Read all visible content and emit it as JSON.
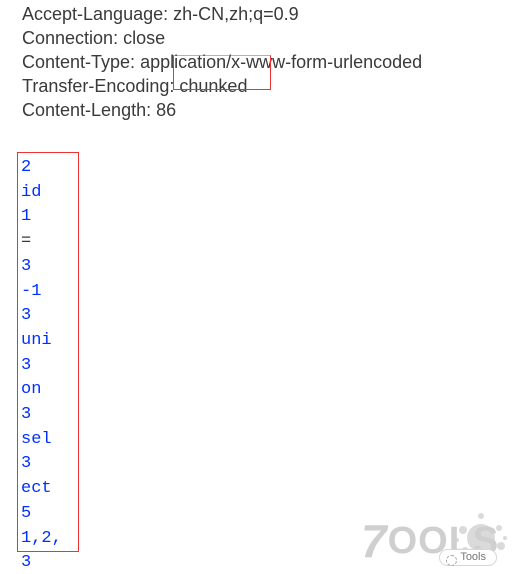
{
  "headers": [
    {
      "name": "Accept-Language",
      "value": "zh-CN,zh;q=0.9"
    },
    {
      "name": "Connection",
      "value": "close"
    },
    {
      "name": "Content-Type",
      "value": "application/x-www-form-urlencoded"
    },
    {
      "name": "Transfer-Encoding",
      "value": "chunked"
    },
    {
      "name": "Content-Length",
      "value": "86"
    }
  ],
  "body_lines": [
    {
      "t": "2",
      "c": "data"
    },
    {
      "t": "id",
      "c": "data"
    },
    {
      "t": "1",
      "c": "data"
    },
    {
      "t": "=",
      "c": "plain"
    },
    {
      "t": "3",
      "c": "data"
    },
    {
      "t": "-1",
      "c": "data"
    },
    {
      "t": "3",
      "c": "data"
    },
    {
      "t": "uni",
      "c": "data"
    },
    {
      "t": "3",
      "c": "data"
    },
    {
      "t": "on",
      "c": "data"
    },
    {
      "t": "3",
      "c": "data"
    },
    {
      "t": "sel",
      "c": "data"
    },
    {
      "t": "3",
      "c": "data"
    },
    {
      "t": "ect",
      "c": "data"
    },
    {
      "t": "5",
      "c": "data"
    },
    {
      "t": " 1,2,",
      "c": "data"
    },
    {
      "t": "3",
      "c": "data"
    }
  ],
  "watermark": {
    "brand": "7OOLS",
    "badge": "Tools"
  }
}
